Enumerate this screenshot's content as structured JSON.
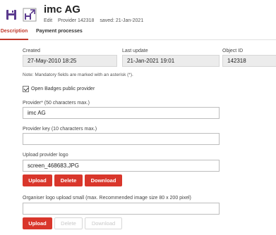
{
  "header": {
    "icons": [
      "save-icon",
      "save-and-close-icon"
    ],
    "title": "imc AG",
    "edit_label": "Edit",
    "provider_id_label": "Provider 142318",
    "saved_label": "saved: 21-Jan-2021"
  },
  "tabs": [
    {
      "label": "Description",
      "active": true
    },
    {
      "label": "Payment processes",
      "active": false
    }
  ],
  "info": {
    "created_label": "Created",
    "created_value": "27-May-2010 18:25",
    "updated_label": "Last update",
    "updated_value": "21-Jan-2021 19:01",
    "object_id_label": "Object ID",
    "object_id_value": "142318"
  },
  "note": "Note: Mandatory fields are marked with an asterisk (*).",
  "open_badges": {
    "label": "Open Badges public provider",
    "checked": true
  },
  "provider": {
    "label": "Provider* (50 characters max.)",
    "value": "imc AG"
  },
  "provider_key": {
    "label": "Provider key (10 characters max.)",
    "value": ""
  },
  "provider_logo": {
    "label": "Upload provider logo",
    "value": "screen_468683.JPG",
    "upload": "Upload",
    "delete": "Delete",
    "download": "Download"
  },
  "organiser_logo": {
    "label": "Organiser logo upload small (max. Recommended image size 80 x 200 pixel)",
    "value": "",
    "upload": "Upload",
    "delete": "Delete",
    "download": "Download"
  },
  "colors": {
    "accent": "#d9362b",
    "readonly_bg": "#ececec",
    "icon_purple": "#5b3a8e"
  }
}
